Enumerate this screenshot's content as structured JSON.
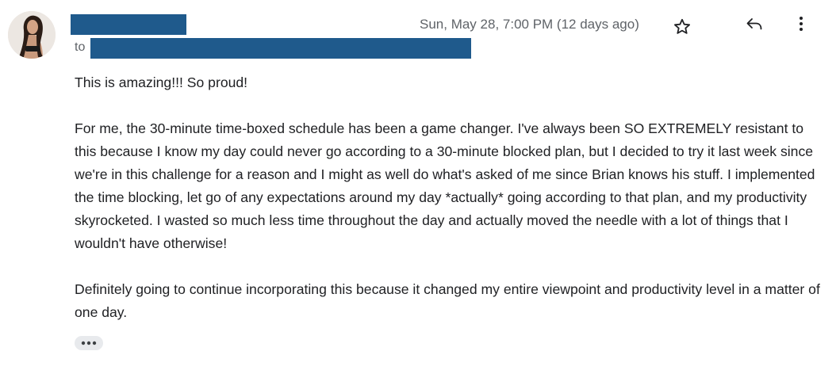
{
  "header": {
    "to_label": "to",
    "date": "Sun, May 28, 7:00 PM (12 days ago)"
  },
  "icons": {
    "star": "star-icon",
    "reply": "reply-icon",
    "more": "more-vert-icon",
    "ellipsis": "ellipsis-icon"
  },
  "message": {
    "paragraphs": [
      "This is amazing!!! So proud!",
      "For me, the 30-minute time-boxed schedule has been a game changer. I've always been SO EXTREMELY resistant to this because I know my day could never go according to a 30-minute blocked plan, but I decided to try it last week since we're in this challenge for a reason and I might as well do what's asked of me since Brian knows his stuff. I implemented the time blocking, let go of any expectations around my day *actually* going according to that plan, and my productivity skyrocketed. I wasted so much less time throughout the day and actually moved the needle with a lot of things that I wouldn't have otherwise!",
      "Definitely going to continue incorporating this because it changed my entire viewpoint and productivity level in a matter of one day."
    ]
  },
  "colors": {
    "redaction": "#1f5a8c",
    "icon": "#5f6368",
    "text": "#202124"
  }
}
